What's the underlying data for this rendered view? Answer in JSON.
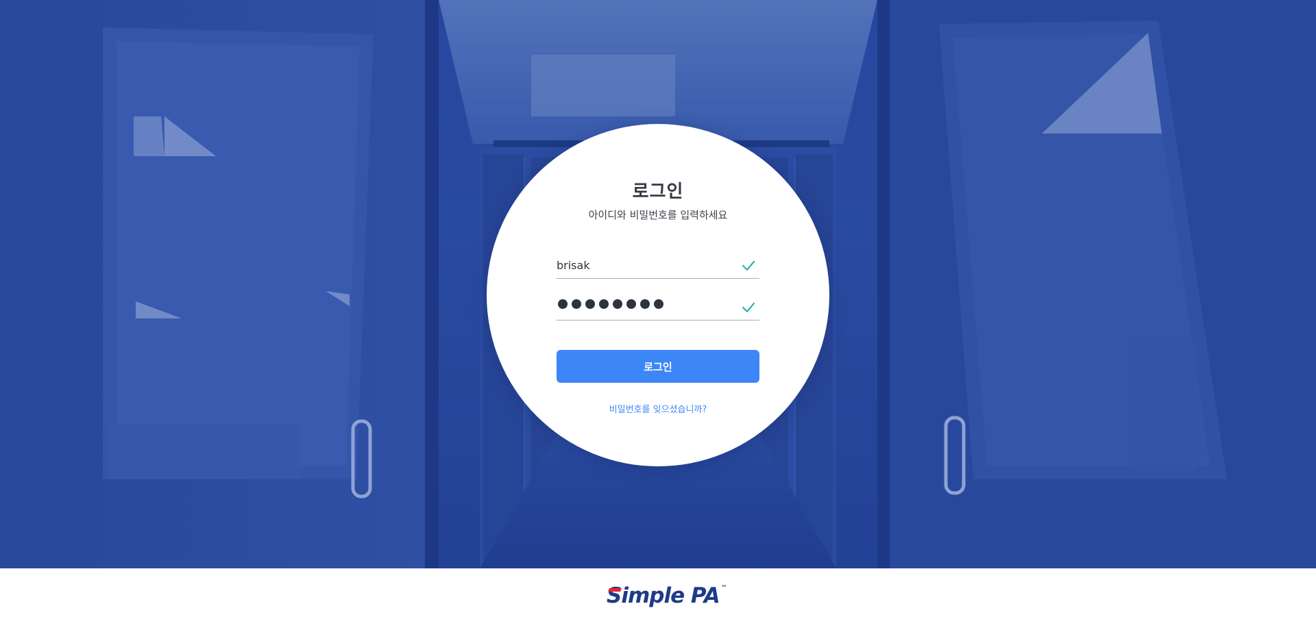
{
  "login": {
    "title": "로그인",
    "subtitle": "아이디와 비밀번호를 입력하세요",
    "username_value": "brisak",
    "password_value": "••••••••",
    "button_label": "로그인",
    "forgot_link": "비밀번호를 잊으셨습니까?"
  },
  "footer": {
    "logo_text": "Simple PA",
    "logo_mark": "™"
  },
  "colors": {
    "primary": "#3d86f7",
    "check": "#2ab5a8",
    "background": "#2d4fa8",
    "logo_blue": "#1f3a8a",
    "logo_red": "#e5262b"
  },
  "icons": {
    "username_valid": "check-icon",
    "password_valid": "check-icon"
  }
}
